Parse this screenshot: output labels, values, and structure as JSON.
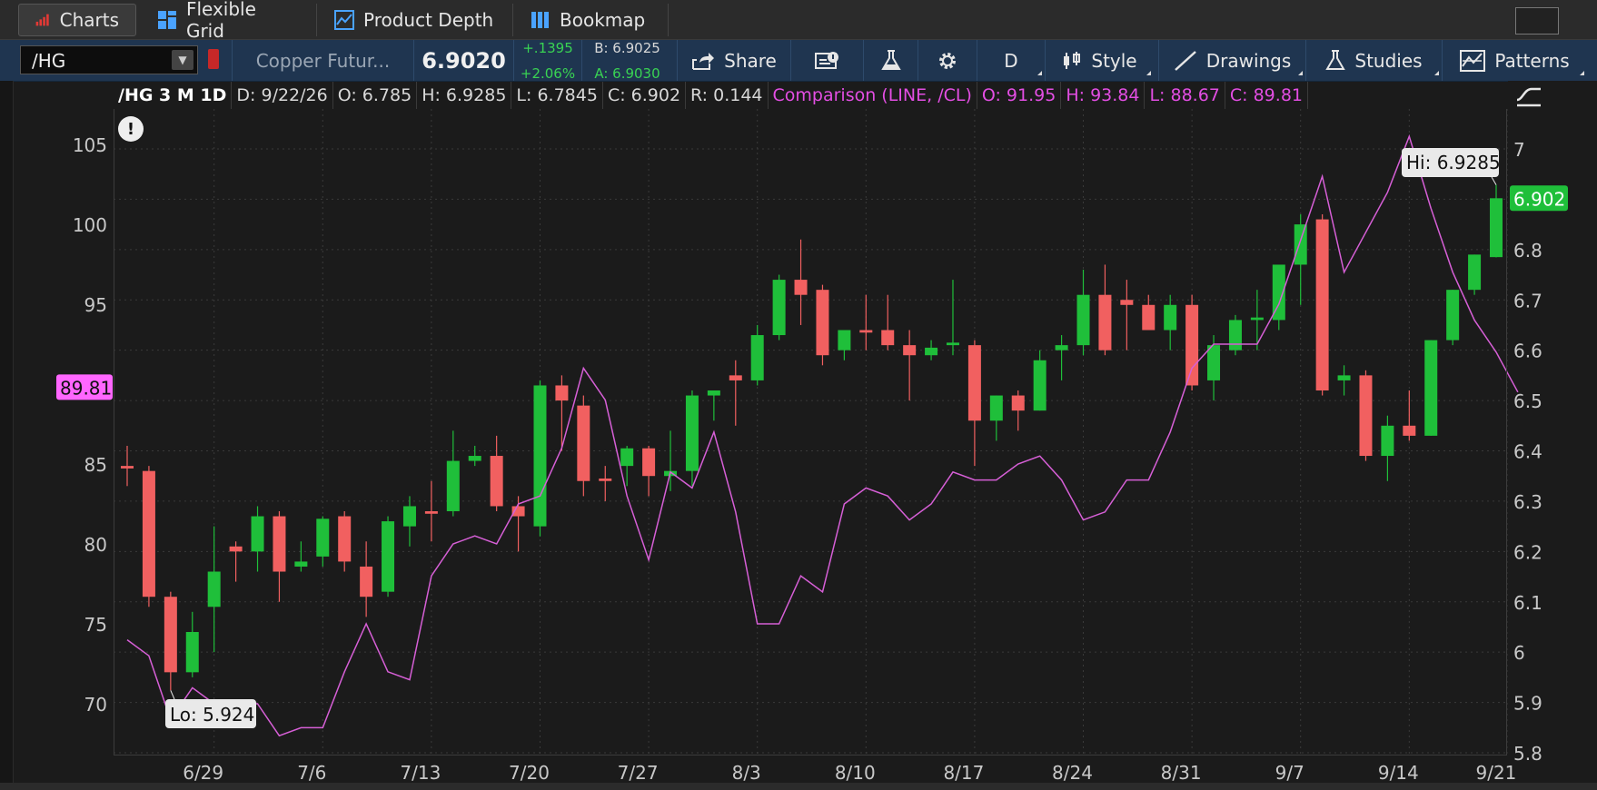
{
  "tabs": [
    {
      "label": "Charts",
      "icon": "bar-chart-icon",
      "active": true
    },
    {
      "label": "Flexible Grid",
      "icon": "grid-icon"
    },
    {
      "label": "Product Depth",
      "icon": "depth-icon"
    },
    {
      "label": "Bookmap",
      "icon": "bookmap-icon"
    }
  ],
  "toolbar": {
    "symbol": "/HG",
    "description": "Copper Futur...",
    "last": "6.9020",
    "change": "+.1395",
    "change_pct": "+2.06%",
    "bid": "B: 6.9025",
    "ask": "A: 6.9030",
    "share": "Share",
    "timeframe": "D",
    "style": "Style",
    "drawings": "Drawings",
    "studies": "Studies",
    "patterns": "Patterns"
  },
  "header": {
    "symbol": "/HG 3 M 1D",
    "date": "D: 9/22/26",
    "open": "O: 6.785",
    "high": "H: 6.9285",
    "low": "L: 6.7845",
    "close": "C: 6.902",
    "range": "R: 0.144",
    "comparison": "Comparison (LINE, /CL)",
    "cmp_open": "O: 91.95",
    "cmp_high": "H: 93.84",
    "cmp_low": "L: 88.67",
    "cmp_close": "C: 89.81"
  },
  "colors": {
    "up": "#1fbf3a",
    "down": "#f16060",
    "comparison": "#d65fd6",
    "grid": "#3a3a3a",
    "price_tag": "#1fbf3a",
    "cmp_tag": "#ff66ff"
  },
  "chart_data": {
    "type": "candlestick",
    "right_axis": {
      "ticks": [
        "7",
        "6.9",
        "6.8",
        "6.7",
        "6.6",
        "6.5",
        "6.4",
        "6.3",
        "6.2",
        "6.1",
        "6",
        "5.9",
        "5.8"
      ],
      "range": [
        5.8,
        7.0
      ]
    },
    "left_axis": {
      "ticks": [
        "105",
        "100",
        "95",
        "90",
        "85",
        "80",
        "75",
        "70"
      ],
      "range": [
        67,
        106
      ],
      "label": "Comparison /CL"
    },
    "x_ticks": [
      "6/29",
      "7/6",
      "7/13",
      "7/20",
      "7/27",
      "8/3",
      "8/10",
      "8/17",
      "8/24",
      "8/31",
      "9/7",
      "9/14",
      "9/21"
    ],
    "hi_label": "Hi: 6.9285",
    "lo_label": "Lo: 5.924",
    "last_price_label": "6.902",
    "comparison_last_label": "89.81",
    "series": [
      {
        "name": "/HG",
        "candles": [
          {
            "o": 6.37,
            "h": 6.41,
            "l": 6.33,
            "c": 6.365
          },
          {
            "o": 6.36,
            "h": 6.37,
            "l": 6.09,
            "c": 6.11
          },
          {
            "o": 6.11,
            "h": 6.12,
            "l": 5.924,
            "c": 5.96
          },
          {
            "o": 5.96,
            "h": 6.08,
            "l": 5.95,
            "c": 6.04
          },
          {
            "o": 6.09,
            "h": 6.25,
            "l": 6.0,
            "c": 6.16
          },
          {
            "o": 6.21,
            "h": 6.22,
            "l": 6.14,
            "c": 6.2
          },
          {
            "o": 6.2,
            "h": 6.29,
            "l": 6.16,
            "c": 6.27
          },
          {
            "o": 6.27,
            "h": 6.28,
            "l": 6.1,
            "c": 6.16
          },
          {
            "o": 6.17,
            "h": 6.22,
            "l": 6.16,
            "c": 6.18
          },
          {
            "o": 6.19,
            "h": 6.27,
            "l": 6.17,
            "c": 6.265
          },
          {
            "o": 6.27,
            "h": 6.28,
            "l": 6.16,
            "c": 6.18
          },
          {
            "o": 6.17,
            "h": 6.22,
            "l": 6.07,
            "c": 6.11
          },
          {
            "o": 6.12,
            "h": 6.27,
            "l": 6.11,
            "c": 6.26
          },
          {
            "o": 6.25,
            "h": 6.31,
            "l": 6.21,
            "c": 6.29
          },
          {
            "o": 6.28,
            "h": 6.34,
            "l": 6.22,
            "c": 6.275
          },
          {
            "o": 6.28,
            "h": 6.44,
            "l": 6.27,
            "c": 6.38
          },
          {
            "o": 6.38,
            "h": 6.41,
            "l": 6.37,
            "c": 6.39
          },
          {
            "o": 6.39,
            "h": 6.43,
            "l": 6.28,
            "c": 6.29
          },
          {
            "o": 6.29,
            "h": 6.31,
            "l": 6.2,
            "c": 6.27
          },
          {
            "o": 6.25,
            "h": 6.54,
            "l": 6.23,
            "c": 6.53
          },
          {
            "o": 6.53,
            "h": 6.55,
            "l": 6.4,
            "c": 6.5
          },
          {
            "o": 6.49,
            "h": 6.51,
            "l": 6.31,
            "c": 6.34
          },
          {
            "o": 6.345,
            "h": 6.37,
            "l": 6.3,
            "c": 6.34
          },
          {
            "o": 6.37,
            "h": 6.41,
            "l": 6.33,
            "c": 6.405
          },
          {
            "o": 6.405,
            "h": 6.41,
            "l": 6.31,
            "c": 6.35
          },
          {
            "o": 6.35,
            "h": 6.44,
            "l": 6.32,
            "c": 6.36
          },
          {
            "o": 6.36,
            "h": 6.52,
            "l": 6.33,
            "c": 6.51
          },
          {
            "o": 6.51,
            "h": 6.52,
            "l": 6.46,
            "c": 6.52
          },
          {
            "o": 6.55,
            "h": 6.58,
            "l": 6.45,
            "c": 6.54
          },
          {
            "o": 6.54,
            "h": 6.65,
            "l": 6.53,
            "c": 6.63
          },
          {
            "o": 6.63,
            "h": 6.75,
            "l": 6.62,
            "c": 6.74
          },
          {
            "o": 6.74,
            "h": 6.82,
            "l": 6.65,
            "c": 6.71
          },
          {
            "o": 6.72,
            "h": 6.73,
            "l": 6.57,
            "c": 6.59
          },
          {
            "o": 6.6,
            "h": 6.64,
            "l": 6.58,
            "c": 6.64
          },
          {
            "o": 6.64,
            "h": 6.71,
            "l": 6.6,
            "c": 6.635
          },
          {
            "o": 6.64,
            "h": 6.71,
            "l": 6.6,
            "c": 6.61
          },
          {
            "o": 6.61,
            "h": 6.64,
            "l": 6.5,
            "c": 6.59
          },
          {
            "o": 6.59,
            "h": 6.62,
            "l": 6.58,
            "c": 6.605
          },
          {
            "o": 6.61,
            "h": 6.74,
            "l": 6.59,
            "c": 6.615
          },
          {
            "o": 6.61,
            "h": 6.62,
            "l": 6.37,
            "c": 6.46
          },
          {
            "o": 6.46,
            "h": 6.51,
            "l": 6.42,
            "c": 6.51
          },
          {
            "o": 6.51,
            "h": 6.52,
            "l": 6.44,
            "c": 6.48
          },
          {
            "o": 6.48,
            "h": 6.6,
            "l": 6.48,
            "c": 6.58
          },
          {
            "o": 6.6,
            "h": 6.63,
            "l": 6.54,
            "c": 6.61
          },
          {
            "o": 6.61,
            "h": 6.76,
            "l": 6.59,
            "c": 6.71
          },
          {
            "o": 6.71,
            "h": 6.77,
            "l": 6.59,
            "c": 6.6
          },
          {
            "o": 6.7,
            "h": 6.74,
            "l": 6.6,
            "c": 6.69
          },
          {
            "o": 6.69,
            "h": 6.71,
            "l": 6.64,
            "c": 6.64
          },
          {
            "o": 6.64,
            "h": 6.71,
            "l": 6.6,
            "c": 6.69
          },
          {
            "o": 6.69,
            "h": 6.71,
            "l": 6.52,
            "c": 6.53
          },
          {
            "o": 6.54,
            "h": 6.63,
            "l": 6.5,
            "c": 6.61
          },
          {
            "o": 6.6,
            "h": 6.67,
            "l": 6.59,
            "c": 6.66
          },
          {
            "o": 6.66,
            "h": 6.72,
            "l": 6.6,
            "c": 6.665
          },
          {
            "o": 6.66,
            "h": 6.76,
            "l": 6.64,
            "c": 6.77
          },
          {
            "o": 6.77,
            "h": 6.87,
            "l": 6.69,
            "c": 6.85
          },
          {
            "o": 6.86,
            "h": 6.87,
            "l": 6.51,
            "c": 6.52
          },
          {
            "o": 6.54,
            "h": 6.57,
            "l": 6.51,
            "c": 6.55
          },
          {
            "o": 6.55,
            "h": 6.56,
            "l": 6.38,
            "c": 6.39
          },
          {
            "o": 6.39,
            "h": 6.47,
            "l": 6.34,
            "c": 6.45
          },
          {
            "o": 6.45,
            "h": 6.52,
            "l": 6.42,
            "c": 6.43
          },
          {
            "o": 6.43,
            "h": 6.62,
            "l": 6.43,
            "c": 6.62
          },
          {
            "o": 6.62,
            "h": 6.72,
            "l": 6.61,
            "c": 6.72
          },
          {
            "o": 6.72,
            "h": 6.79,
            "l": 6.71,
            "c": 6.79
          },
          {
            "o": 6.785,
            "h": 6.9285,
            "l": 6.7845,
            "c": 6.902
          }
        ]
      },
      {
        "name": "Comparison /CL",
        "values": [
          74,
          73,
          69,
          71,
          70,
          70,
          70,
          68,
          68.5,
          68.5,
          72,
          75,
          72,
          71.5,
          78,
          80,
          80.5,
          80,
          82.5,
          83,
          86,
          91,
          89,
          83,
          79,
          84.5,
          83.5,
          87,
          82,
          75,
          75,
          78,
          77,
          82.5,
          83.5,
          83,
          81.5,
          82.5,
          84.5,
          84,
          84,
          85,
          85.5,
          84,
          81.5,
          82,
          84,
          84,
          87,
          91,
          92.5,
          92.5,
          92.5,
          95,
          99,
          103,
          97,
          99.5,
          102,
          105.5,
          101,
          97,
          94,
          92,
          89.5
        ]
      }
    ]
  }
}
